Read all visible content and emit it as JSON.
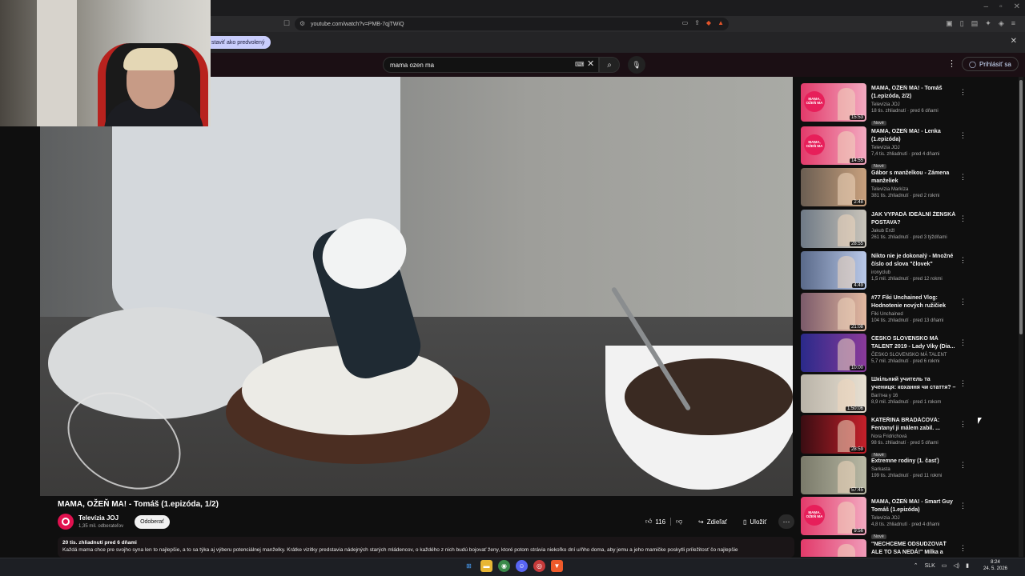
{
  "browser": {
    "url": "youtube.com/watch?v=PMB-7qjTWiQ",
    "infobar_text": "staviť ako predvolený",
    "window_controls": [
      "–",
      "▫",
      "✕"
    ]
  },
  "header": {
    "search_value": "mama ozen ma",
    "signin_label": "Prihlásiť sa"
  },
  "video": {
    "title": "MAMA, OŽEŇ MA! - Tomáš (1.epizóda, 1/2)",
    "channel": "Televízia JOJ",
    "subscribers": "1,35 mil. odberateľov",
    "subscribe_label": "Odoberať",
    "likes": "116",
    "share_label": "Zdieľať",
    "save_label": "Uložiť",
    "desc_meta": "20 tis. zhliadnutí  pred 6 dňami",
    "desc_text": "Každá mama chce pre svojho syna len to najlepšie, a to sa týka aj výberu potenciálnej manželky. Krátke vizitky predstavia nádejných starých mládencov, o každého z nich budú bojovať ženy, ktoré potom strávia niekoľko dní u/ňho doma, aby jemu a jeho mamičke poskytli príležitosť čo najlepšie"
  },
  "recommendations": [
    {
      "title": "MAMA, OŽEŇ MA! - Tomáš (1.epizóda, 2/2)",
      "channel": "Televízia JOJ",
      "views": "18 tis. zhliadnutí · pred 6 dňami",
      "badge": "Nové",
      "duration": "15:53",
      "logo": "MAMA, OŽEŇ MA"
    },
    {
      "title": "MAMA, OŽEŇ MA! - Lenka (1.epizóda)",
      "channel": "Televízia JOJ",
      "views": "7,4 tis. zhliadnutí · pred 4 dňami",
      "badge": "Nové",
      "duration": "14:55",
      "logo": "MAMA, OŽEŇ MA"
    },
    {
      "title": "Gábor s manželkou - Zámena manželiek",
      "channel": "Televízia Markíza",
      "views": "381 tis. zhliadnutí · pred 2 rokmi",
      "badge": "",
      "duration": "2:48",
      "logo": ""
    },
    {
      "title": "JAK VYPADÁ IDEÁLNÍ ŽENSKÁ POSTAVA?",
      "channel": "Jakub Enžl",
      "views": "261 tis. zhliadnutí · pred 3 týždňami",
      "badge": "",
      "duration": "28:55",
      "logo": ""
    },
    {
      "title": "Nikto nie je dokonalý - Množné číslo od slova \"človek\"",
      "channel": "ironyclub",
      "views": "1,5 mil. zhliadnutí · pred 12 rokmi",
      "badge": "",
      "duration": "4:49",
      "logo": ""
    },
    {
      "title": "#77 Fiki Unchained Vlog: Hodnotenie nových ružičiek",
      "channel": "Fiki Unchained",
      "views": "104 tis. zhliadnutí · pred 13 dňami",
      "badge": "",
      "duration": "21:08",
      "logo": ""
    },
    {
      "title": "ČESKO SLOVENSKO MÁ TALENT 2019 - Lady Viky (Dia...",
      "channel": "ČESKO SLOVENSKO MÁ TALENT",
      "views": "5,7 mil. zhliadnutí · pred 6 rokmi",
      "badge": "",
      "duration": "10:00",
      "logo": ""
    },
    {
      "title": "Шкільний учитель та учениця: кохання чи стаття? – Вагітна...",
      "channel": "Вагітна у 16",
      "views": "8,9 mil. zhliadnutí · pred 1 rokom",
      "badge": "",
      "duration": "1:50:06",
      "logo": ""
    },
    {
      "title": "KATEŘINA BRADÁČOVÁ: Fentanyl ji málem zabil. ...",
      "channel": "Nora Fridrichová",
      "views": "98 tis. zhliadnutí · pred 5 dňami",
      "badge": "Nové",
      "duration": "28:59",
      "logo": ""
    },
    {
      "title": "Extremne rodiny (1. časť)",
      "channel": "Sarkasta",
      "views": "199 tis. zhliadnutí · pred 11 rokmi",
      "badge": "",
      "duration": "57:45",
      "logo": ""
    },
    {
      "title": "MAMA, OŽEŇ MA! - Smart Guy Tomáš (1.epizóda)",
      "channel": "Televízia JOJ",
      "views": "4,8 tis. zhliadnutí · pred 4 dňami",
      "badge": "Nové",
      "duration": "9:56",
      "logo": "MAMA, OŽEŇ MA"
    },
    {
      "title": "\"NECHCEME ODSUDZOVAŤ ALE TO SA NEDÁ!\" Mílka a Heidi z ...",
      "channel": "",
      "views": "",
      "badge": "",
      "duration": "",
      "logo": ""
    }
  ],
  "taskbar": {
    "lang": "SLK",
    "time": "8:24",
    "date": "24. 5. 2026"
  }
}
